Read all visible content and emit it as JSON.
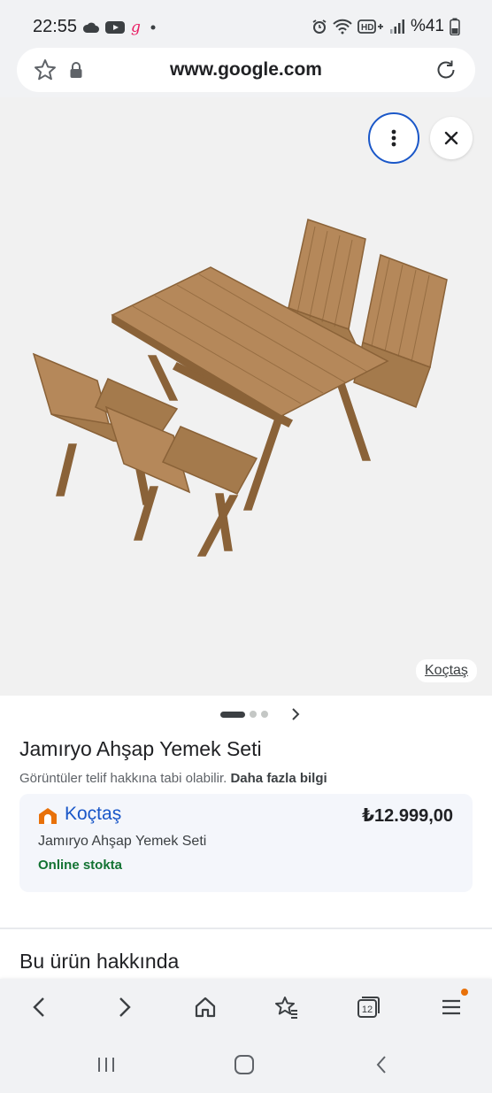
{
  "status_bar": {
    "time": "22:55",
    "battery": "%41",
    "icons": [
      "cloud-icon",
      "youtube-icon",
      "app-g-icon",
      "dot-icon",
      "alarm-icon",
      "wifi-icon",
      "hd-volte-icon",
      "signal-icon",
      "battery-icon"
    ]
  },
  "browser": {
    "url": "www.google.com"
  },
  "image_viewer": {
    "source_label": "Koçtaş",
    "carousel_total": 3,
    "carousel_active": 1
  },
  "product": {
    "title": "Jamıryo Ahşap Yemek Seti",
    "copyright_text": "Görüntüler telif hakkına tabi olabilir.",
    "more_info_link": "Daha fazla bilgi"
  },
  "offer": {
    "store_name": "Koçtaş",
    "price": "₺12.999,00",
    "product_name": "Jamıryo Ahşap Yemek Seti",
    "stock_status": "Online stokta"
  },
  "about_section": {
    "title": "Bu ürün hakkında"
  },
  "bottom_nav": {
    "items": [
      "back-icon",
      "forward-icon",
      "home-icon",
      "bookmarks-icon",
      "tabs-icon",
      "menu-icon"
    ],
    "tab_count": "12"
  },
  "colors": {
    "accent": "#1a57c8",
    "stock_green": "#137333",
    "store_orange": "#e8710a",
    "wood": "#b5885a"
  }
}
